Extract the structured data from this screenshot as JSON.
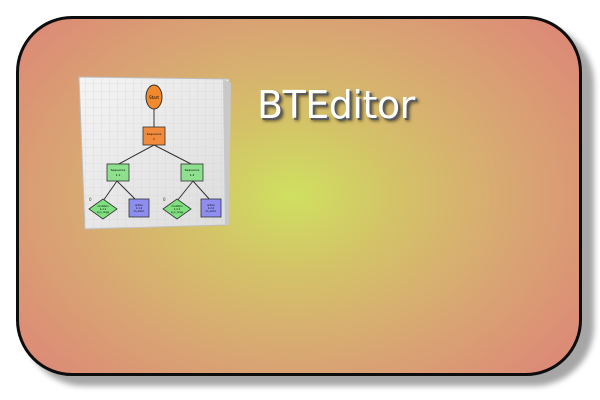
{
  "app": {
    "title": "BTEditor"
  },
  "preview": {
    "root_label": "Start",
    "sequence_label": "Sequence",
    "sequence_id": "1",
    "children": [
      {
        "label": "Sequence",
        "id": "1.1",
        "leaves": [
          {
            "kind": "condition",
            "label": "condition",
            "id": "1.1.1",
            "detail": "is_in_range"
          },
          {
            "kind": "action",
            "label": "action",
            "id": "1.1.2",
            "detail": "do_action"
          }
        ]
      },
      {
        "label": "Sequence",
        "id": "1.2",
        "leaves": [
          {
            "kind": "condition",
            "label": "condition",
            "id": "1.2.1",
            "detail": "is_in_range"
          },
          {
            "kind": "action",
            "label": "action",
            "id": "1.2.2",
            "detail": "do_action"
          }
        ]
      }
    ]
  },
  "colors": {
    "root_node": "#f08a2c",
    "sequence_root": "#f08a3c",
    "sequence_child": "#8ee08e",
    "condition": "#7ee07e",
    "action": "#8e8ef0",
    "card_border": "#0d0d0d",
    "title_text": "#ffffff"
  }
}
